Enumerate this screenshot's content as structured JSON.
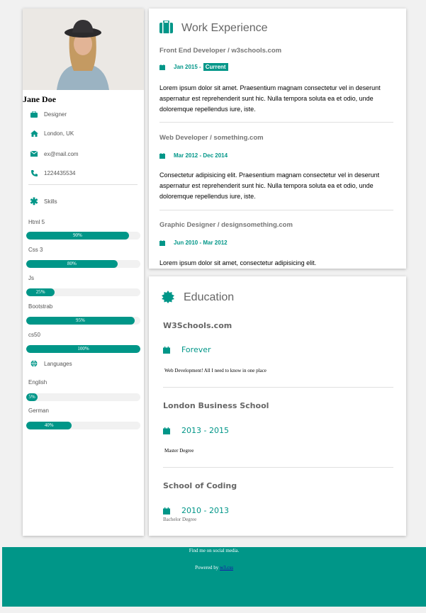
{
  "colors": {
    "accent": "#009688",
    "background": "#f1f1f1"
  },
  "profile": {
    "name": "Jane Doe",
    "photo_icon": "avatar-photo",
    "details": [
      {
        "icon": "briefcase-icon",
        "text": "Designer"
      },
      {
        "icon": "home-icon",
        "text": "London, UK"
      },
      {
        "icon": "envelope-icon",
        "text": "ex@mail.com"
      },
      {
        "icon": "phone-icon",
        "text": "1224435534"
      }
    ]
  },
  "skills": {
    "heading": "Skills",
    "items": [
      {
        "label": "Html 5",
        "percent_text": "90%",
        "percent": 90
      },
      {
        "label": "Css 3",
        "percent_text": "80%",
        "percent": 80
      },
      {
        "label": "Js",
        "percent_text": "25%",
        "percent": 25
      },
      {
        "label": "Bootstrab",
        "percent_text": "95%",
        "percent": 95
      },
      {
        "label": "cs50",
        "percent_text": "100%",
        "percent": 100
      }
    ]
  },
  "languages": {
    "heading": "Languages",
    "items": [
      {
        "label": "English",
        "percent_text": "5%",
        "percent": 5
      },
      {
        "label": "German",
        "percent_text": "40%",
        "percent": 40
      }
    ]
  },
  "work": {
    "title": "Work Experience",
    "jobs": [
      {
        "title": "Front End Developer / w3schools.com",
        "date": "Jan 2015 -",
        "badge": "Current",
        "desc": "Lorem ipsum dolor sit amet. Praesentium magnam consectetur vel in deserunt aspernatur est reprehenderit sunt hic. Nulla tempora soluta ea et odio, unde doloremque repellendus iure, iste."
      },
      {
        "title": "Web Developer / something.com",
        "date": "Mar 2012 - Dec 2014",
        "desc": "Consectetur adipisicing elit. Praesentium magnam consectetur vel in deserunt aspernatur est reprehenderit sunt hic. Nulla tempora soluta ea et odio, unde doloremque repellendus iure, iste."
      },
      {
        "title": "Graphic Designer / designsomething.com",
        "date": "Jun 2010 - Mar 2012",
        "desc": "Lorem ipsum dolor sit amet, consectetur adipisicing elit."
      }
    ]
  },
  "education": {
    "title": "Education",
    "schools": [
      {
        "name": "W3Schools.com",
        "date": "Forever",
        "desc": "Web Development! All I need to know in one place"
      },
      {
        "name": "London Business School",
        "date": "2013 - 2015",
        "desc": "Master Degree"
      },
      {
        "name": "School of Coding",
        "date": "2010 - 2013",
        "desc": "Bachelor Degree"
      }
    ]
  },
  "footer": {
    "line1": "Find me on social media.",
    "powered_prefix": "Powered by ",
    "powered_link": "w3.css"
  }
}
